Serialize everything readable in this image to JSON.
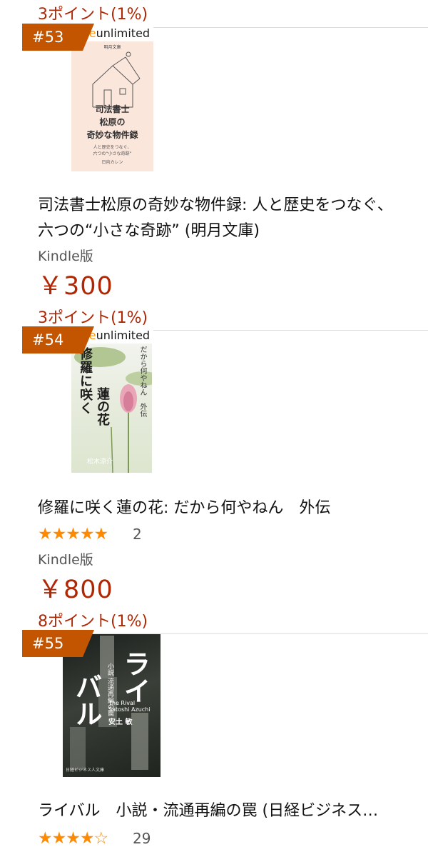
{
  "items": [
    {
      "points_above": "3ポイント(1%)",
      "rank": "#53",
      "badge": {
        "part1": "ndle",
        "part2": "unlimited"
      },
      "cover": {
        "publisher": "明月文庫",
        "title_lines": [
          "司法書士",
          "松原の",
          "奇妙な物件録"
        ],
        "subtitle_lines": [
          "人と歴史をつなぐ、",
          "六つの“小さな奇跡”"
        ],
        "author": "日向カレン"
      },
      "title_line1": "司法書士松原の奇妙な物件録: 人と歴史をつなぐ、",
      "title_line2": "六つの“小さな奇跡” (明月文庫)",
      "format": "Kindle版",
      "price": "￥300",
      "points_below": "3ポイント(1%)"
    },
    {
      "rank": "#54",
      "badge": {
        "part1": "ndle",
        "part2": "unlimited"
      },
      "cover": {
        "title_a": "修羅に咲く",
        "title_b": "蓮の花",
        "side": "だから何やねん　外伝",
        "author": "松木涼介"
      },
      "title_line1": "修羅に咲く蓮の花: だから何やねん　外伝",
      "stars": "★★★★★",
      "rating_count": "2",
      "format": "Kindle版",
      "price": "￥800",
      "points_below": "8ポイント(1%)"
    },
    {
      "rank": "#55",
      "cover": {
        "big1": "ライ",
        "big2": "バル",
        "sub": "小説 流通再編の罠",
        "en_title": "The Rival",
        "en_author": "Satoshi Azuchi",
        "author": "安土 敏",
        "publisher": "日経ビジネス人文庫"
      },
      "title_line1": "ライバル　小説・流通再編の罠 (日経ビジネス…",
      "stars": "★★★★☆",
      "rating_count": "29"
    }
  ],
  "colors": {
    "price": "#b12704",
    "badge": "#c45500",
    "stars": "#ff8a00",
    "kindle_unlimited_orange": "#ff9900"
  }
}
